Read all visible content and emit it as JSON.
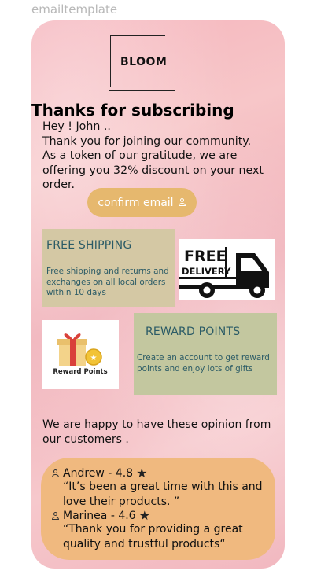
{
  "frame": {
    "label": "emailtemplate"
  },
  "logo": {
    "text": "BLOOM"
  },
  "header": {
    "title": "Thanks for subscribing"
  },
  "greeting": {
    "lines": [
      "Hey ! John ..",
      "Thank you for  joining our community.",
      "As a token of our gratitude, we are",
      "offering you 32% discount on your next",
      "order."
    ]
  },
  "confirm": {
    "label": "confirm email"
  },
  "shipping": {
    "title": "FREE SHIPPING",
    "lines": [
      "Free shipping and returns and",
      "exchanges on all local orders",
      "within 10 days"
    ]
  },
  "delivery_image": {
    "line1": "FREE",
    "line2": "DELIVERY"
  },
  "reward_image": {
    "label": "Reward Points"
  },
  "rewards": {
    "title": "REWARD POINTS",
    "lines": [
      "Create an account to get reward",
      "points and enjoy lots of gifts"
    ]
  },
  "opinion": {
    "lines": [
      "We are happy to have these opinion from",
      " our customers ."
    ]
  },
  "reviews": [
    {
      "name": "Andrew - 4.8",
      "quote_lines": [
        "“It’s been a great time with this and",
        " love their products. ”"
      ]
    },
    {
      "name": "Marinea - 4.6",
      "quote_lines": [
        "“Thank you for providing a great",
        "quality and trustful products“"
      ]
    }
  ],
  "colors": {
    "card_pink": "#f5b4bc",
    "confirm_button": "#e6b86e",
    "shipping_box": "#d4c8a4",
    "reward_box": "#c3c79f",
    "reviews_box": "#f0b97f",
    "accent_text": "#2b5b66"
  }
}
